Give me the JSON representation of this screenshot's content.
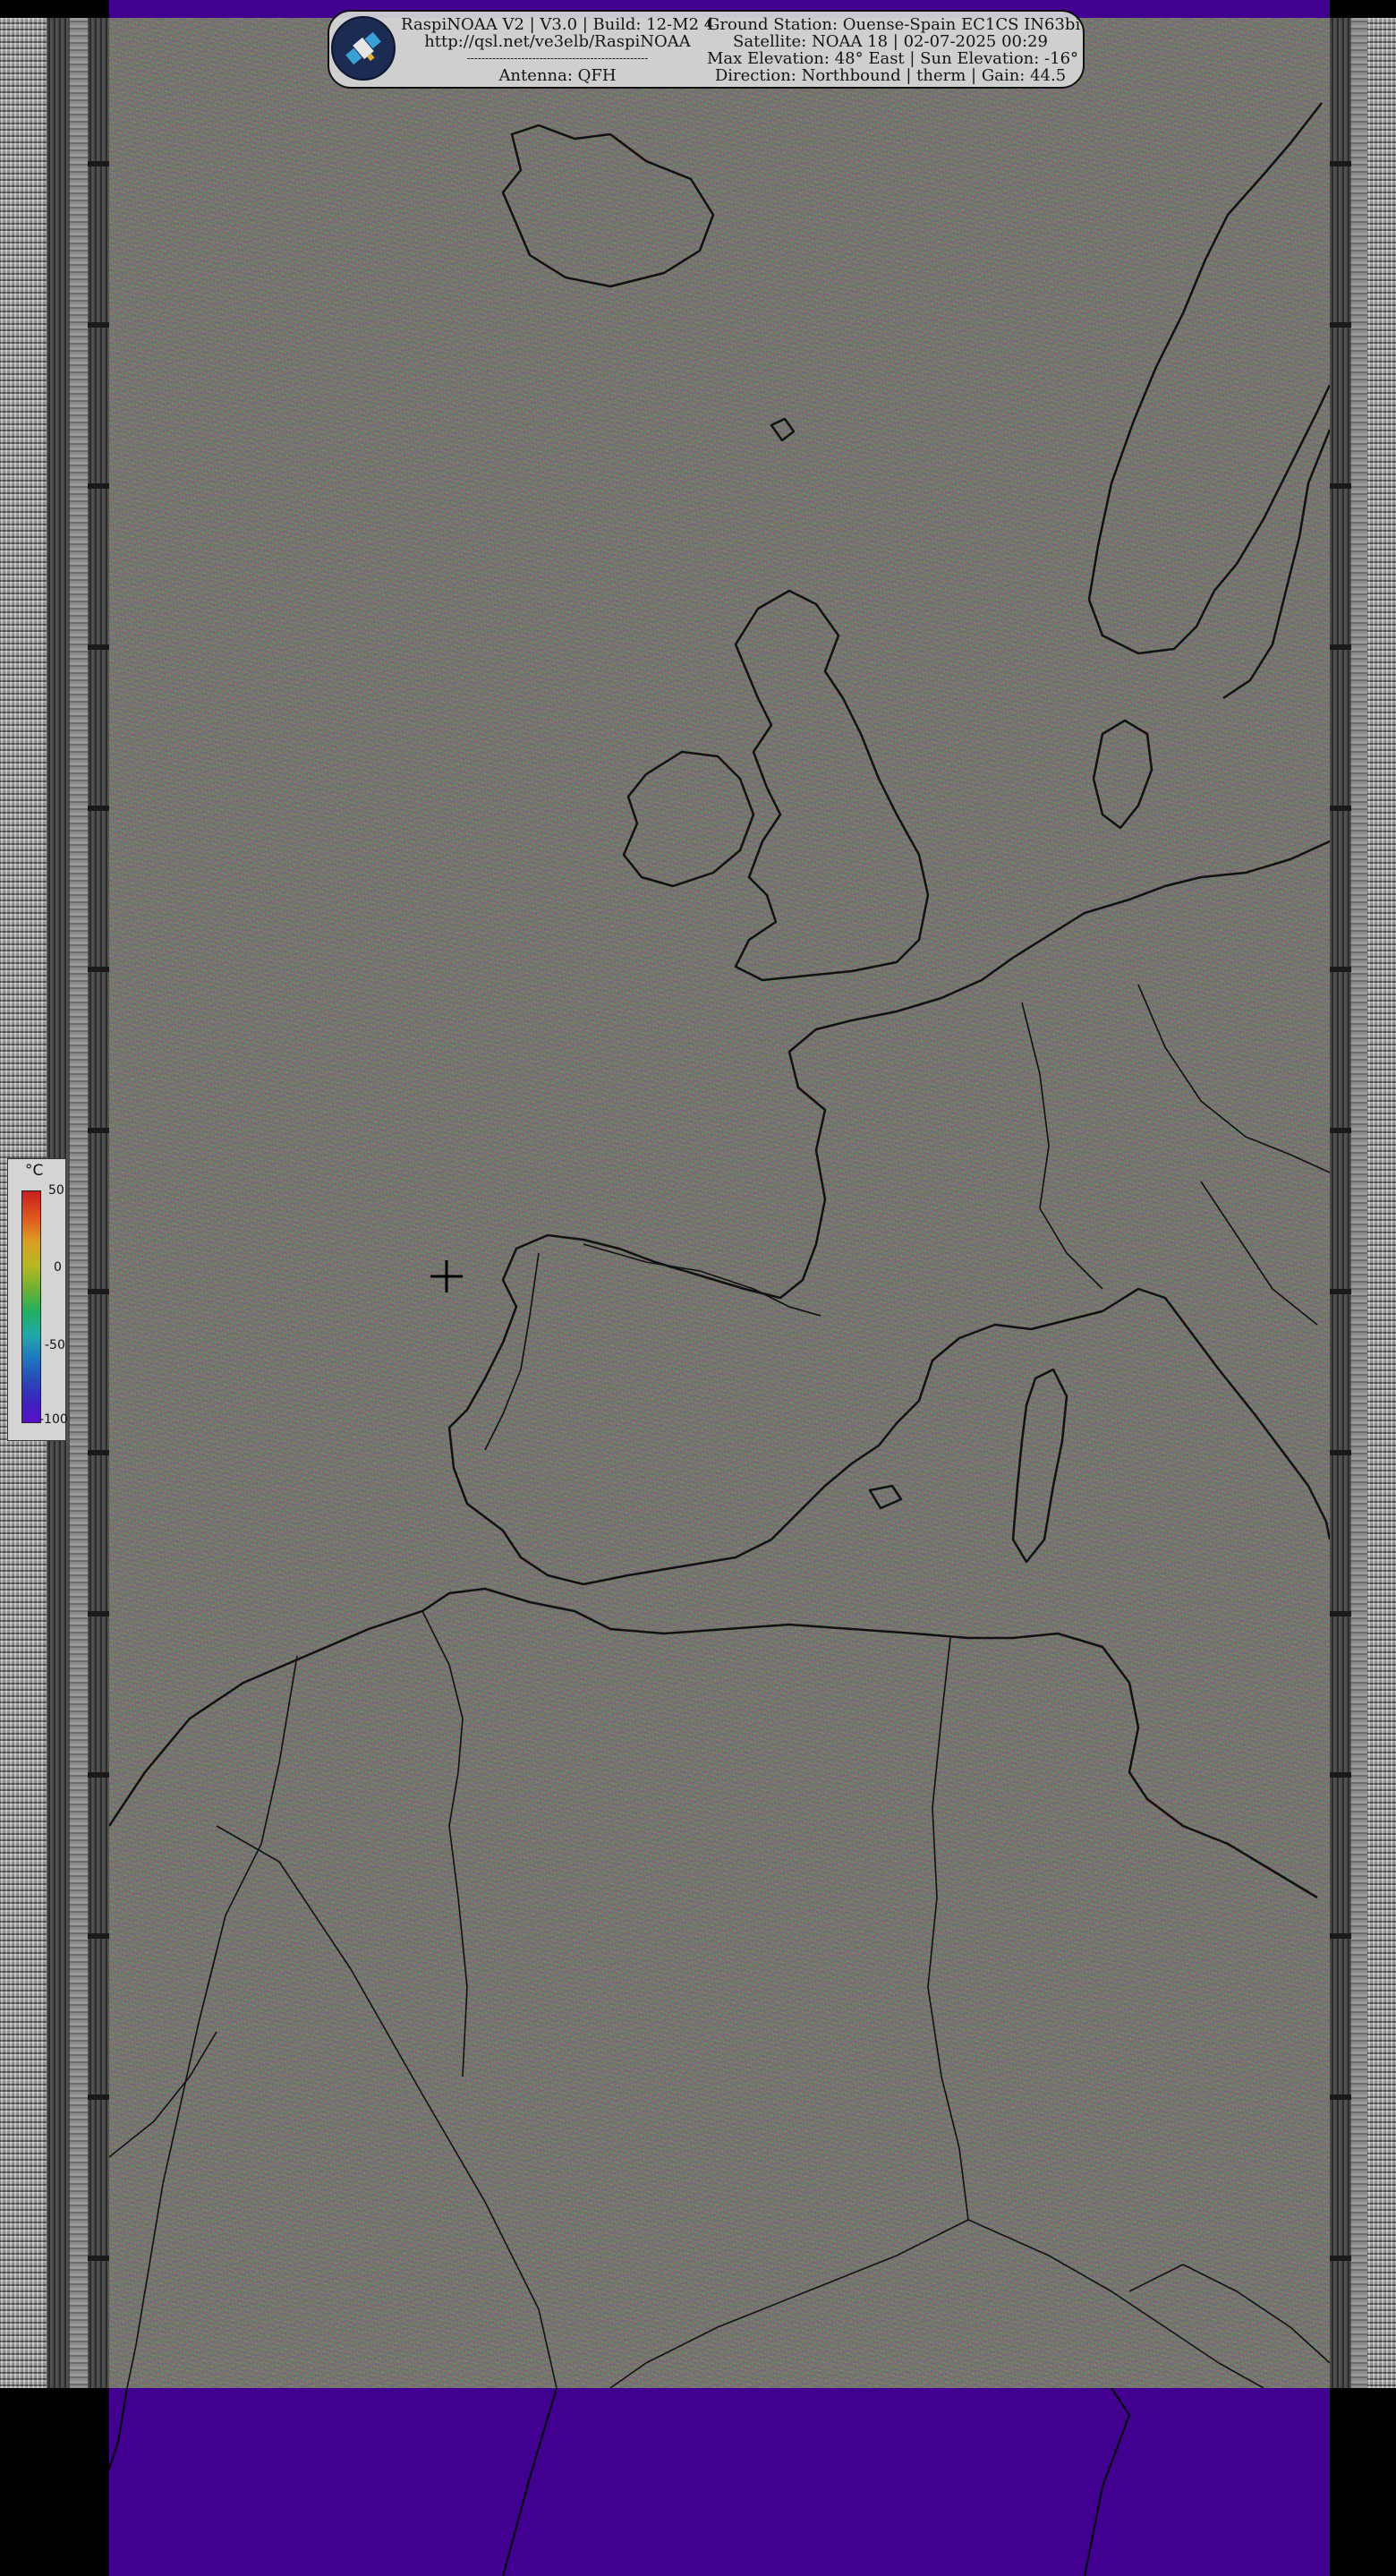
{
  "header": {
    "left_lines": [
      "RaspiNOAA V2 | V3.0 | Build: 12-M2 4",
      "http://qsl.net/ve3elb/RaspiNOAA",
      "--------------------------------------------------",
      "Antenna: QFH"
    ],
    "right_lines": [
      "Ground Station: Ouense-Spain EC1CS  IN63bi",
      "Satellite: NOAA 18 | 02-07-2025 00:29",
      "Max Elevation: 48° East | Sun Elevation: -16°",
      "Direction: Northbound | therm | Gain: 44.5"
    ],
    "logo_icon": "satellite-icon"
  },
  "scale": {
    "unit": "°C",
    "labels": [
      "50",
      "0",
      "-50",
      "-100"
    ]
  },
  "colors": {
    "band": "#420090",
    "border": "#000000",
    "coastline": "#111111",
    "marker": "#000000"
  },
  "map": {
    "marker_icon": "crosshair-icon",
    "projection": "satellite swath, northbound pass over Europe and North Africa"
  }
}
